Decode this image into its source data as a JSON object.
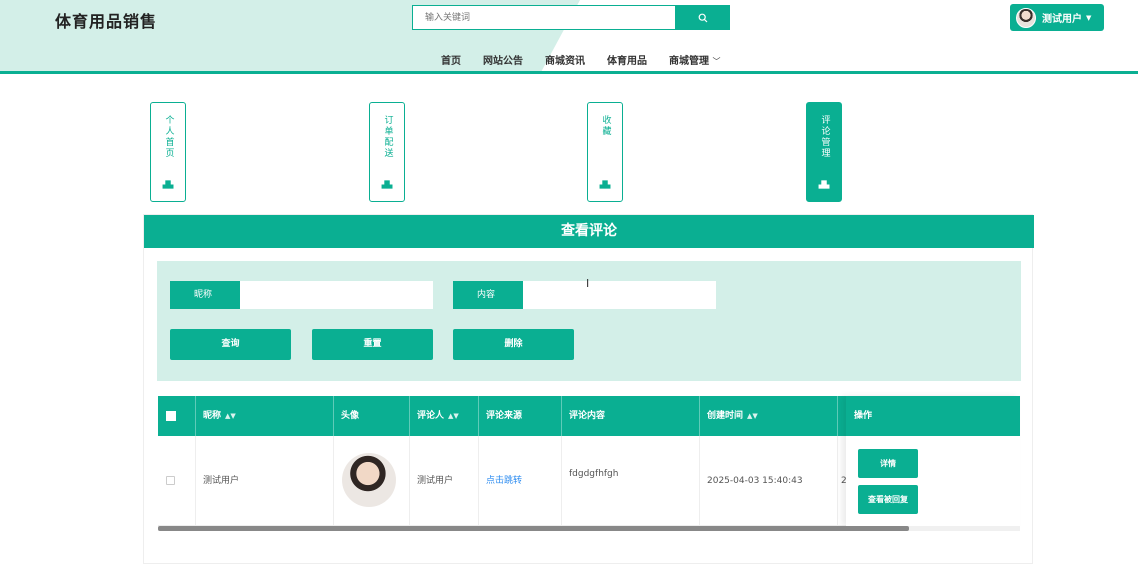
{
  "header": {
    "site_title": "体育用品销售",
    "search_placeholder": "输入关键词",
    "user_name": "测试用户"
  },
  "nav": [
    "首页",
    "网站公告",
    "商城资讯",
    "体育用品",
    "商城管理"
  ],
  "tiles": [
    {
      "label": "个人首页",
      "active": false
    },
    {
      "label": "订单配送",
      "active": false
    },
    {
      "label": "收藏",
      "active": false
    },
    {
      "label": "评论管理",
      "active": true
    }
  ],
  "card_title": "查看评论",
  "filters": {
    "nickname_label": "昵称",
    "content_label": "内容",
    "query_btn": "查询",
    "reset_btn": "重置",
    "delete_btn": "删除"
  },
  "table": {
    "headers": {
      "nickname": "昵称",
      "avatar": "头像",
      "commenter": "评论人",
      "source": "评论来源",
      "content": "评论内容",
      "created": "创建时间",
      "actions": "操作"
    },
    "rows": [
      {
        "nickname": "测试用户",
        "commenter": "测试用户",
        "source": "点击跳转",
        "content": "fdgdgfhfgh",
        "created": "2025-04-03 15:40:43",
        "extra": "2",
        "detail_btn": "详情",
        "view_reply_btn": "查看被回复"
      }
    ]
  },
  "colors": {
    "accent": "#0aaf92",
    "light": "#d3efe8"
  }
}
